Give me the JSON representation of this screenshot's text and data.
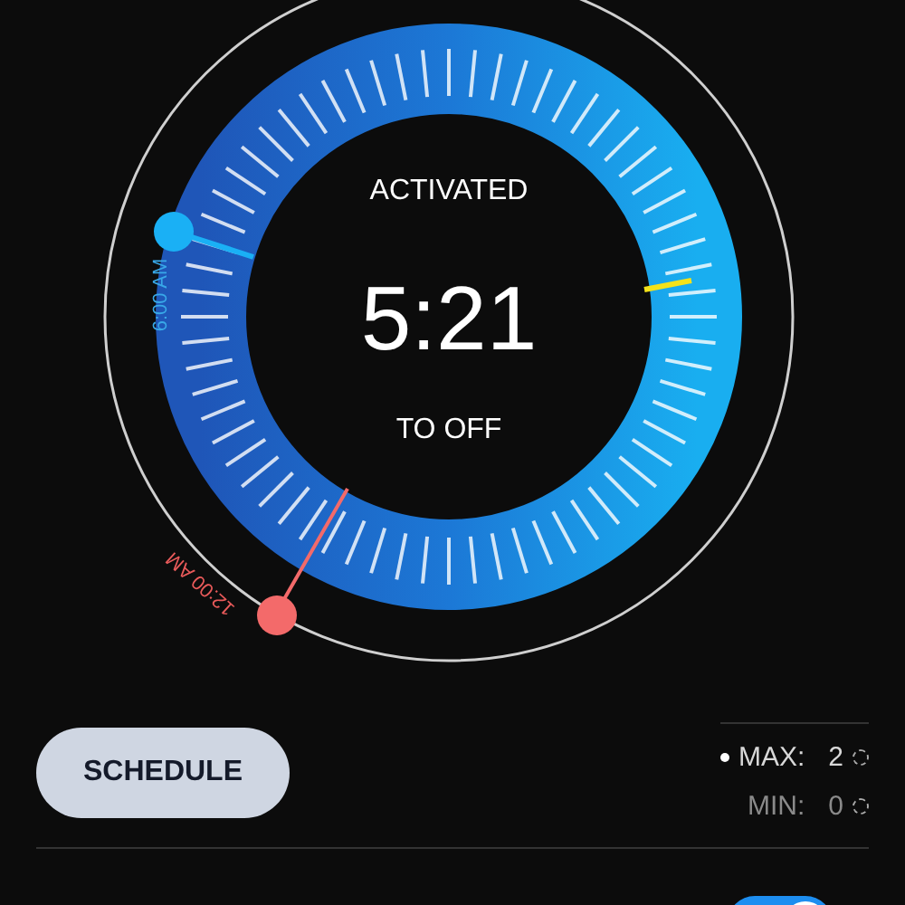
{
  "dial": {
    "status": "ACTIVATED",
    "time": "5:21",
    "caption": "TO OFF",
    "start_label": "6:00 AM",
    "end_label": "12:00 AM"
  },
  "schedule_button": {
    "label": "SCHEDULE"
  },
  "readings": [
    {
      "label": "MAX:",
      "value": "2",
      "selected": true
    },
    {
      "label": "MIN:",
      "value": "0",
      "selected": false
    }
  ],
  "toggle": {
    "on": true
  }
}
